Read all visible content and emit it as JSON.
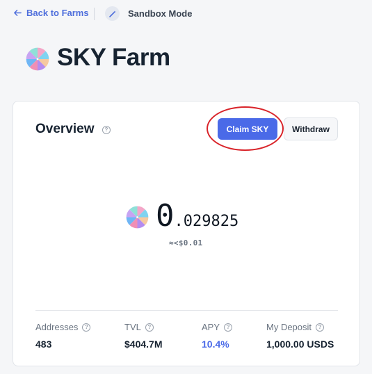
{
  "nav": {
    "back_label": "Back to Farms",
    "sandbox_label": "Sandbox Mode"
  },
  "farm": {
    "title": "SKY Farm",
    "logo_icon": "sky-pinwheel-icon"
  },
  "overview": {
    "title": "Overview",
    "claim_label": "Claim SKY",
    "withdraw_label": "Withdraw",
    "reward_integer": "0",
    "reward_decimal": ".029825",
    "reward_usd": "≈<$0.01"
  },
  "stats": [
    {
      "label": "Addresses",
      "value": "483"
    },
    {
      "label": "TVL",
      "value": "$404.7M"
    },
    {
      "label": "APY",
      "value": "10.4%"
    },
    {
      "label": "My Deposit",
      "value": "1,000.00 USDS"
    }
  ],
  "colors": {
    "accent": "#4a6ae8",
    "annotation_ring": "#d9242a",
    "background": "#f5f6f8"
  }
}
